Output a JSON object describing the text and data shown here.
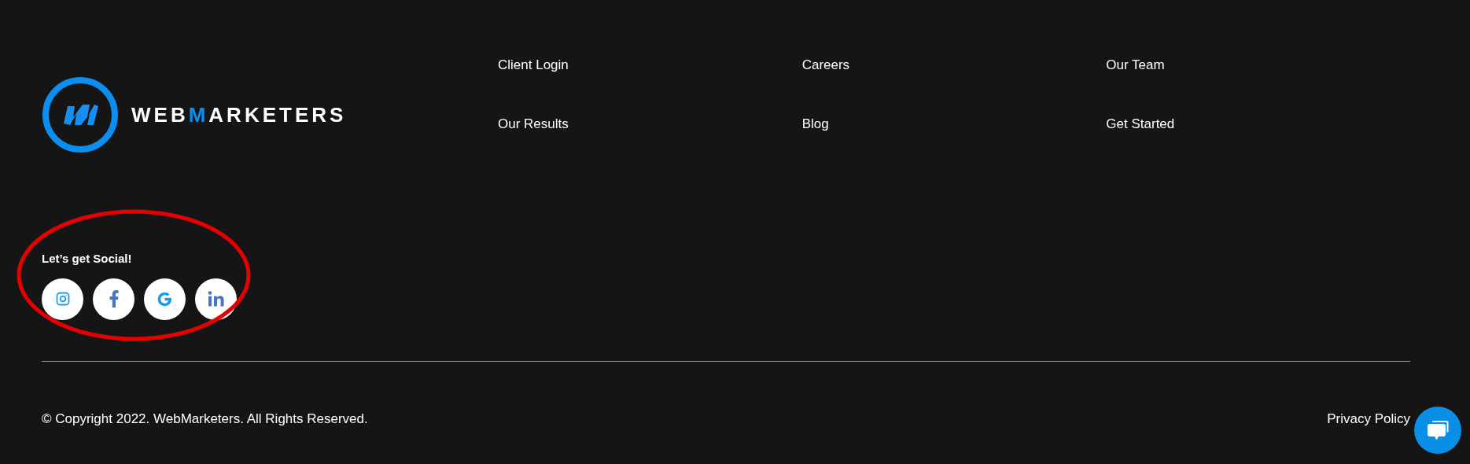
{
  "logo": {
    "wordmark": [
      {
        "text": "WEB",
        "accent": false
      },
      {
        "text": "M",
        "accent": true
      },
      {
        "text": "ARKETERS",
        "accent": false
      }
    ]
  },
  "nav_links": [
    {
      "label": "Client Login"
    },
    {
      "label": "Careers"
    },
    {
      "label": "Our Team"
    },
    {
      "label": "Our Results"
    },
    {
      "label": "Blog"
    },
    {
      "label": "Get Started"
    }
  ],
  "social": {
    "heading": "Let’s get Social!",
    "buttons": [
      {
        "kind": "instagram"
      },
      {
        "kind": "facebook"
      },
      {
        "kind": "google"
      },
      {
        "kind": "linkedin"
      }
    ],
    "highlight": {
      "kind": "ellipse",
      "color": "#e60000"
    }
  },
  "copyright": "© Copyright 2022. WebMarketers. All Rights Reserved.",
  "privacy_link": "Privacy Policy",
  "chat_button": {
    "kind": "chat"
  }
}
